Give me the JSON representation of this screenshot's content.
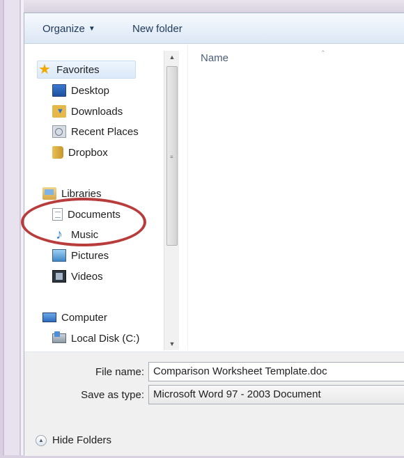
{
  "toolbar": {
    "organize_label": "Organize",
    "new_folder_label": "New folder"
  },
  "nav": {
    "favorites": {
      "label": "Favorites",
      "icon": "star-icon"
    },
    "favorites_items": [
      {
        "label": "Desktop",
        "icon": "desktop-icon"
      },
      {
        "label": "Downloads",
        "icon": "downloads-icon"
      },
      {
        "label": "Recent Places",
        "icon": "recent-places-icon"
      },
      {
        "label": "Dropbox",
        "icon": "dropbox-icon"
      }
    ],
    "libraries": {
      "label": "Libraries",
      "icon": "libraries-icon"
    },
    "libraries_items": [
      {
        "label": "Documents",
        "icon": "documents-icon"
      },
      {
        "label": "Music",
        "icon": "music-icon"
      },
      {
        "label": "Pictures",
        "icon": "pictures-icon"
      },
      {
        "label": "Videos",
        "icon": "videos-icon"
      }
    ],
    "computer": {
      "label": "Computer",
      "icon": "computer-icon"
    },
    "computer_items": [
      {
        "label": "Local Disk (C:)",
        "icon": "local-disk-icon"
      }
    ]
  },
  "content": {
    "column_name": "Name"
  },
  "form": {
    "file_name_label": "File name:",
    "file_name_value": "Comparison Worksheet Template.doc",
    "save_as_type_label": "Save as type:",
    "save_as_type_value": "Microsoft Word 97 - 2003 Document"
  },
  "footer": {
    "hide_folders_label": "Hide Folders"
  },
  "colors": {
    "highlight_ring": "#b83c3c",
    "toolbar_text": "#1e395b"
  }
}
